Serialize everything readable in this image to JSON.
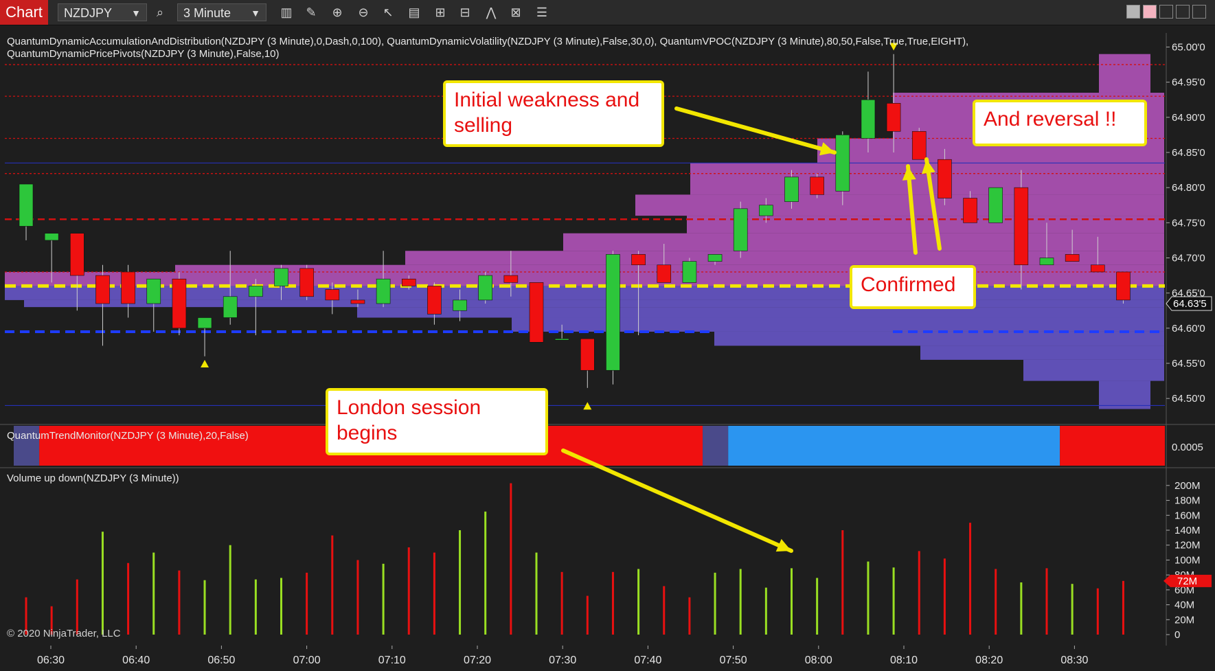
{
  "toolbar": {
    "chart_label": "Chart",
    "instrument": "NZDJPY",
    "timeframe": "3 Minute"
  },
  "indicators": {
    "line1": "QuantumDynamicAccumulationAndDistribution(NZDJPY (3 Minute),0,Dash,0,100), QuantumDynamicVolatility(NZDJPY (3 Minute),False,30,0), QuantumVPOC(NZDJPY (3 Minute),80,50,False,True,True,EIGHT),",
    "line2": "QuantumDynamicPricePivots(NZDJPY (3 Minute),False,10)",
    "trend_monitor": "QuantumTrendMonitor(NZDJPY (3 Minute),20,False)",
    "volume": "Volume up down(NZDJPY (3 Minute))"
  },
  "callouts": {
    "weakness": [
      "Initial weakness and",
      "selling"
    ],
    "reversal": "And reversal !!",
    "confirmed": "Confirmed",
    "london": [
      "London session",
      "begins"
    ]
  },
  "copyright": "© 2020 NinjaTrader, LLC",
  "chart_data": {
    "type": "candlestick",
    "price_axis": {
      "ylim": [
        64.465,
        65.02
      ],
      "ticks": [
        65.0,
        64.95,
        64.9,
        64.85,
        64.8,
        64.75,
        64.7,
        64.65,
        64.6,
        64.55,
        64.5
      ],
      "tick_labels": [
        "65.00'0",
        "64.95'0",
        "64.90'0",
        "64.85'0",
        "64.80'0",
        "64.75'0",
        "64.70'0",
        "64.65'0",
        "64.60'0",
        "64.55'0",
        "64.50'0"
      ],
      "current_price": 64.635,
      "current_price_label": "64.63'5"
    },
    "time_axis": {
      "labels": [
        "06:30",
        "06:40",
        "06:50",
        "07:00",
        "07:10",
        "07:20",
        "07:30",
        "07:40",
        "07:50",
        "08:00",
        "08:10",
        "08:20",
        "08:30"
      ]
    },
    "candles": [
      {
        "o": 64.745,
        "h": 64.805,
        "l": 64.725,
        "c": 64.805
      },
      {
        "o": 64.725,
        "h": 64.735,
        "l": 64.665,
        "c": 64.735
      },
      {
        "o": 64.735,
        "h": 64.735,
        "l": 64.625,
        "c": 64.675
      },
      {
        "o": 64.675,
        "h": 64.69,
        "l": 64.575,
        "c": 64.635
      },
      {
        "o": 64.68,
        "h": 64.69,
        "l": 64.615,
        "c": 64.635
      },
      {
        "o": 64.635,
        "h": 64.66,
        "l": 64.595,
        "c": 64.67
      },
      {
        "o": 64.67,
        "h": 64.68,
        "l": 64.59,
        "c": 64.6
      },
      {
        "o": 64.6,
        "h": 64.61,
        "l": 64.56,
        "c": 64.615
      },
      {
        "o": 64.615,
        "h": 64.71,
        "l": 64.605,
        "c": 64.645
      },
      {
        "o": 64.645,
        "h": 64.67,
        "l": 64.59,
        "c": 64.66
      },
      {
        "o": 64.66,
        "h": 64.69,
        "l": 64.64,
        "c": 64.685
      },
      {
        "o": 64.685,
        "h": 64.69,
        "l": 64.64,
        "c": 64.645
      },
      {
        "o": 64.655,
        "h": 64.665,
        "l": 64.62,
        "c": 64.64
      },
      {
        "o": 64.64,
        "h": 64.655,
        "l": 64.63,
        "c": 64.635
      },
      {
        "o": 64.635,
        "h": 64.71,
        "l": 64.63,
        "c": 64.67
      },
      {
        "o": 64.67,
        "h": 64.675,
        "l": 64.655,
        "c": 64.66
      },
      {
        "o": 64.66,
        "h": 64.665,
        "l": 64.605,
        "c": 64.62
      },
      {
        "o": 64.625,
        "h": 64.655,
        "l": 64.61,
        "c": 64.64
      },
      {
        "o": 64.64,
        "h": 64.68,
        "l": 64.635,
        "c": 64.675
      },
      {
        "o": 64.675,
        "h": 64.71,
        "l": 64.645,
        "c": 64.665
      },
      {
        "o": 64.665,
        "h": 64.665,
        "l": 64.58,
        "c": 64.58
      },
      {
        "o": 64.585,
        "h": 64.605,
        "l": 64.585,
        "c": 64.585
      },
      {
        "o": 64.585,
        "h": 64.585,
        "l": 64.515,
        "c": 64.54
      },
      {
        "o": 64.54,
        "h": 64.71,
        "l": 64.52,
        "c": 64.705
      },
      {
        "o": 64.705,
        "h": 64.71,
        "l": 64.59,
        "c": 64.69
      },
      {
        "o": 64.69,
        "h": 64.72,
        "l": 64.665,
        "c": 64.665
      },
      {
        "o": 64.665,
        "h": 64.7,
        "l": 64.665,
        "c": 64.695
      },
      {
        "o": 64.695,
        "h": 64.705,
        "l": 64.69,
        "c": 64.705
      },
      {
        "o": 64.71,
        "h": 64.78,
        "l": 64.7,
        "c": 64.77
      },
      {
        "o": 64.76,
        "h": 64.785,
        "l": 64.75,
        "c": 64.775
      },
      {
        "o": 64.78,
        "h": 64.825,
        "l": 64.77,
        "c": 64.815
      },
      {
        "o": 64.815,
        "h": 64.82,
        "l": 64.785,
        "c": 64.79
      },
      {
        "o": 64.795,
        "h": 64.88,
        "l": 64.775,
        "c": 64.875
      },
      {
        "o": 64.87,
        "h": 64.965,
        "l": 64.85,
        "c": 64.925
      },
      {
        "o": 64.92,
        "h": 64.99,
        "l": 64.85,
        "c": 64.88
      },
      {
        "o": 64.88,
        "h": 64.885,
        "l": 64.84,
        "c": 64.84
      },
      {
        "o": 64.84,
        "h": 64.855,
        "l": 64.775,
        "c": 64.785
      },
      {
        "o": 64.785,
        "h": 64.795,
        "l": 64.75,
        "c": 64.75
      },
      {
        "o": 64.75,
        "h": 64.8,
        "l": 64.75,
        "c": 64.8
      },
      {
        "o": 64.8,
        "h": 64.825,
        "l": 64.655,
        "c": 64.69
      },
      {
        "o": 64.69,
        "h": 64.75,
        "l": 64.69,
        "c": 64.7
      },
      {
        "o": 64.705,
        "h": 64.74,
        "l": 64.695,
        "c": 64.695
      },
      {
        "o": 64.69,
        "h": 64.73,
        "l": 64.68,
        "c": 64.68
      },
      {
        "o": 64.68,
        "h": 64.68,
        "l": 64.635,
        "c": 64.64
      }
    ],
    "vpoc_price": 64.66,
    "pivot_lines": [
      64.975,
      64.93,
      64.87,
      64.82,
      64.755,
      64.68
    ],
    "support_lines": [
      64.595
    ],
    "blue_lines": [
      64.835,
      64.49
    ],
    "volume_axis": {
      "ylim": [
        0,
        210
      ],
      "tick_labels": [
        "200M",
        "180M",
        "160M",
        "140M",
        "120M",
        "100M",
        "80M",
        "60M",
        "40M",
        "20M",
        "0"
      ],
      "current_label": "72M"
    },
    "volume": [
      {
        "v": 50,
        "d": "down"
      },
      {
        "v": 38,
        "d": "down"
      },
      {
        "v": 74,
        "d": "down"
      },
      {
        "v": 138,
        "d": "up"
      },
      {
        "v": 96,
        "d": "down"
      },
      {
        "v": 110,
        "d": "up"
      },
      {
        "v": 86,
        "d": "down"
      },
      {
        "v": 73,
        "d": "up"
      },
      {
        "v": 120,
        "d": "up"
      },
      {
        "v": 74,
        "d": "up"
      },
      {
        "v": 76,
        "d": "up"
      },
      {
        "v": 83,
        "d": "down"
      },
      {
        "v": 133,
        "d": "down"
      },
      {
        "v": 100,
        "d": "down"
      },
      {
        "v": 95,
        "d": "up"
      },
      {
        "v": 117,
        "d": "down"
      },
      {
        "v": 110,
        "d": "down"
      },
      {
        "v": 140,
        "d": "up"
      },
      {
        "v": 165,
        "d": "up"
      },
      {
        "v": 203,
        "d": "down"
      },
      {
        "v": 110,
        "d": "up"
      },
      {
        "v": 84,
        "d": "down"
      },
      {
        "v": 52,
        "d": "down"
      },
      {
        "v": 84,
        "d": "down"
      },
      {
        "v": 88,
        "d": "up"
      },
      {
        "v": 65,
        "d": "down"
      },
      {
        "v": 50,
        "d": "down"
      },
      {
        "v": 83,
        "d": "up"
      },
      {
        "v": 88,
        "d": "up"
      },
      {
        "v": 63,
        "d": "up"
      },
      {
        "v": 89,
        "d": "up"
      },
      {
        "v": 76,
        "d": "up"
      },
      {
        "v": 140,
        "d": "down"
      },
      {
        "v": 98,
        "d": "up"
      },
      {
        "v": 90,
        "d": "up"
      },
      {
        "v": 112,
        "d": "down"
      },
      {
        "v": 102,
        "d": "down"
      },
      {
        "v": 150,
        "d": "down"
      },
      {
        "v": 88,
        "d": "down"
      },
      {
        "v": 70,
        "d": "up"
      },
      {
        "v": 89,
        "d": "down"
      },
      {
        "v": 68,
        "d": "up"
      },
      {
        "v": 62,
        "d": "down"
      },
      {
        "v": 72,
        "d": "down"
      }
    ],
    "trend_monitor": [
      {
        "from": 0,
        "to": 1,
        "state": "neutral"
      },
      {
        "from": 1,
        "to": 27,
        "state": "down"
      },
      {
        "from": 27,
        "to": 28,
        "state": "neutral"
      },
      {
        "from": 28,
        "to": 41,
        "state": "up"
      },
      {
        "from": 41,
        "to": 44,
        "state": "down"
      }
    ],
    "trend_axis_label": "0.0005",
    "colors": {
      "up": "#2dc63b",
      "down": "#f01010",
      "vol_up": "#9adf22",
      "vol_down": "#e81010",
      "vpoc": "#f2e600",
      "pivot": "#d21010",
      "support": "#1e3cff",
      "trend_up": "#2b95f0",
      "trend_down": "#f01010",
      "trend_neutral": "#4a4a8a"
    }
  }
}
